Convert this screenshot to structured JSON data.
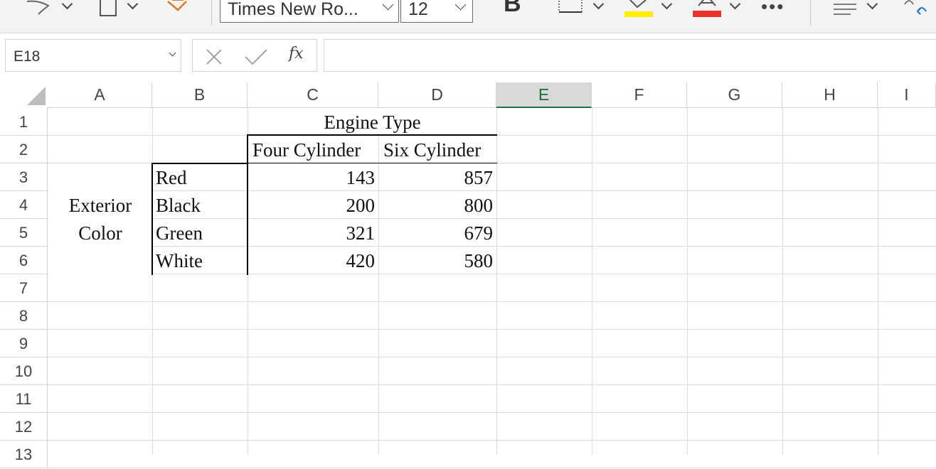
{
  "ribbon": {
    "font_name": "Times New Ro...",
    "font_size": "12",
    "bold_label": "B",
    "more_label": "•••",
    "highlight_color": "#ffee00",
    "font_color": "#e8322b"
  },
  "formula_bar": {
    "name_box": "E18",
    "fx_label": "fx",
    "formula": ""
  },
  "sheet": {
    "columns": [
      "A",
      "B",
      "C",
      "D",
      "E",
      "F",
      "G",
      "H",
      "I"
    ],
    "rows": [
      "1",
      "2",
      "3",
      "4",
      "5",
      "6",
      "7",
      "8",
      "9",
      "10",
      "11",
      "12",
      "13"
    ],
    "selected_column": "E",
    "header_title": "Engine Type",
    "col_headers": [
      "Four Cylinder",
      "Six Cylinder"
    ],
    "row_group": [
      "Exterior",
      "Color"
    ],
    "row_labels": [
      "Red",
      "Black",
      "Green",
      "White"
    ],
    "four_cyl": [
      "143",
      "200",
      "321",
      "420"
    ],
    "six_cyl": [
      "857",
      "800",
      "679",
      "580"
    ]
  }
}
